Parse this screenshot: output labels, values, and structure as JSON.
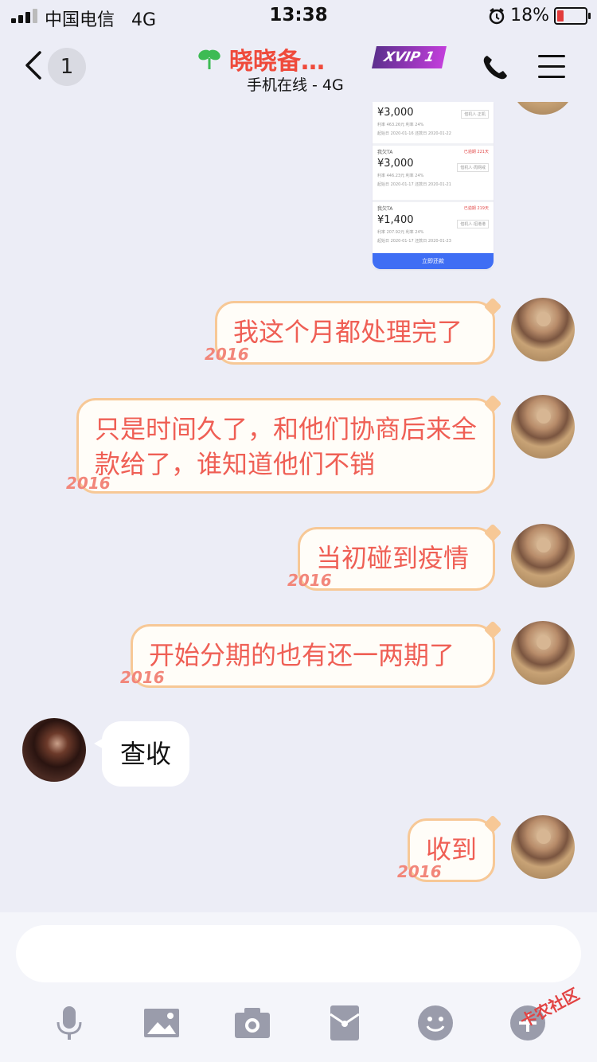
{
  "status_bar": {
    "carrier": "中国电信",
    "network": "4G",
    "time": "13:38",
    "battery": "18%"
  },
  "header": {
    "back_count": "1",
    "contact_name": "晓晓备…",
    "status": "手机在线 - 4G",
    "vip_label": "XVIP 1"
  },
  "shared_screenshot": {
    "loans": [
      {
        "tag": "",
        "amount": "¥3,000",
        "badge": "借机人·正机",
        "meta_left": "利率 463.26元 利率 24%",
        "meta_right": "起始日 2020-01-16 还款日 2020-01-22",
        "overdue": ""
      },
      {
        "tag": "我欠TA",
        "amount": "¥3,000",
        "badge": "借机人·周网戒",
        "meta_left": "利率 446.23元 利率 24%",
        "meta_right": "起始日 2020-01-17 还款日 2020-01-21",
        "overdue": "已逾期 221天"
      },
      {
        "tag": "我欠TA",
        "amount": "¥1,400",
        "badge": "借机人·招港港",
        "meta_left": "利率 207.92元 利率 24%",
        "meta_right": "起始日 2020-01-17 还款日 2020-01-23",
        "overdue": "已逾期 219天"
      }
    ],
    "pay_button": "立即还款"
  },
  "messages": [
    {
      "side": "me",
      "text": "我这个月都处理完了"
    },
    {
      "side": "me",
      "text": "只是时间久了，和他们协商后来全款给了，谁知道他们不销"
    },
    {
      "side": "me",
      "text": "当初碰到疫情"
    },
    {
      "side": "me",
      "text": "开始分期的也有还一两期了"
    },
    {
      "side": "them",
      "text": "查收"
    },
    {
      "side": "me",
      "text": "收到"
    }
  ],
  "bubble_decoration": "2016",
  "input": {
    "placeholder": ""
  },
  "toolbar": {
    "icons": [
      "microphone-icon",
      "image-icon",
      "camera-icon",
      "red-packet-icon",
      "emoji-icon",
      "plus-icon"
    ]
  },
  "watermark": "卡农社区",
  "colors": {
    "bubble_text": "#ef5f55",
    "bubble_border": "#f7c896",
    "name_red": "#ef4a3b",
    "background": "#ecedf6"
  }
}
